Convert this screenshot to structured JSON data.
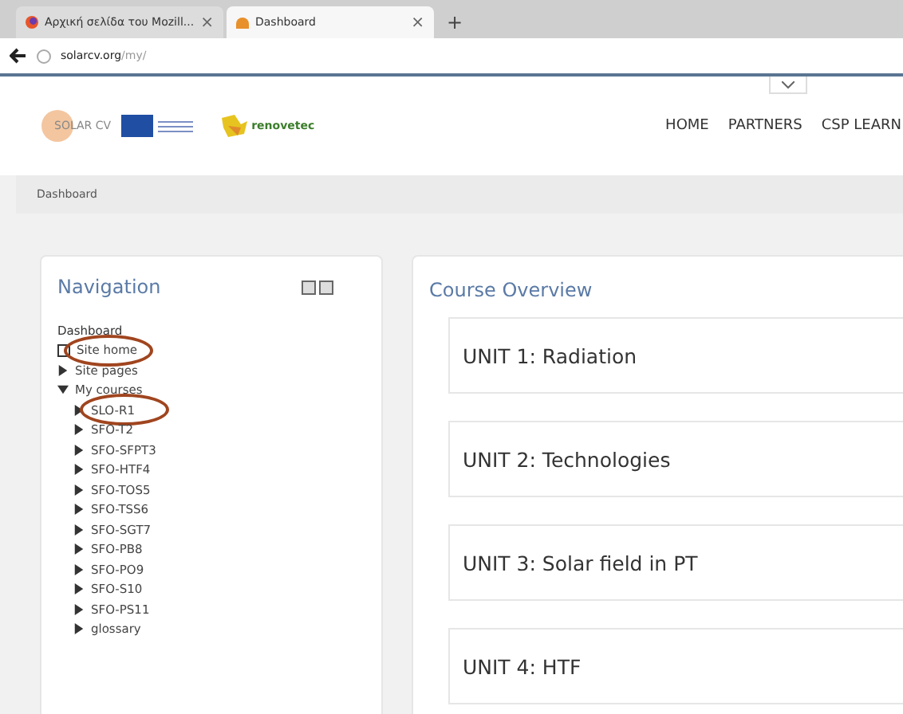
{
  "browser": {
    "tabs": [
      {
        "title": "Αρχική σελίδα του Mozill...",
        "selected": false,
        "close": "×",
        "kind": "browser"
      },
      {
        "title": "Dashboard",
        "selected": true,
        "close": "×",
        "kind": "site"
      }
    ],
    "new_tab": "+",
    "url": {
      "host": "solarcv.org",
      "path": "/my/"
    }
  },
  "header": {
    "logo_text": "SOLAR CV",
    "partner_logo_text": "renovetec",
    "nav": [
      "HOME",
      "PARTNERS",
      "CSP LEARN"
    ]
  },
  "breadcrumb": "Dashboard",
  "navigation": {
    "title": "Navigation",
    "tree": [
      {
        "label": "Dashboard",
        "kind": "root",
        "children": [
          {
            "label": "Site home",
            "kind": "page",
            "circled": true
          },
          {
            "label": "Site pages",
            "kind": "branch",
            "expanded": false
          },
          {
            "label": "My courses",
            "kind": "branch",
            "expanded": true,
            "children": [
              {
                "label": "SLO-R1",
                "kind": "branch",
                "expanded": false,
                "circled": true
              },
              {
                "label": "SFO-T2",
                "kind": "branch",
                "expanded": false
              },
              {
                "label": "SFO-SFPT3",
                "kind": "branch",
                "expanded": false
              },
              {
                "label": "SFO-HTF4",
                "kind": "branch",
                "expanded": false
              },
              {
                "label": "SFO-TOS5",
                "kind": "branch",
                "expanded": false
              },
              {
                "label": "SFO-TSS6",
                "kind": "branch",
                "expanded": false
              },
              {
                "label": "SFO-SGT7",
                "kind": "branch",
                "expanded": false
              },
              {
                "label": "SFO-PB8",
                "kind": "branch",
                "expanded": false
              },
              {
                "label": "SFO-PO9",
                "kind": "branch",
                "expanded": false
              },
              {
                "label": "SFO-S10",
                "kind": "branch",
                "expanded": false
              },
              {
                "label": "SFO-PS11",
                "kind": "branch",
                "expanded": false
              },
              {
                "label": "glossary",
                "kind": "branch",
                "expanded": false
              }
            ]
          }
        ]
      }
    ]
  },
  "course_overview": {
    "title": "Course Overview",
    "units": [
      "UNIT 1: Radiation",
      "UNIT 2: Technologies",
      "UNIT 3: Solar field in PT",
      "UNIT 4: HTF"
    ]
  }
}
